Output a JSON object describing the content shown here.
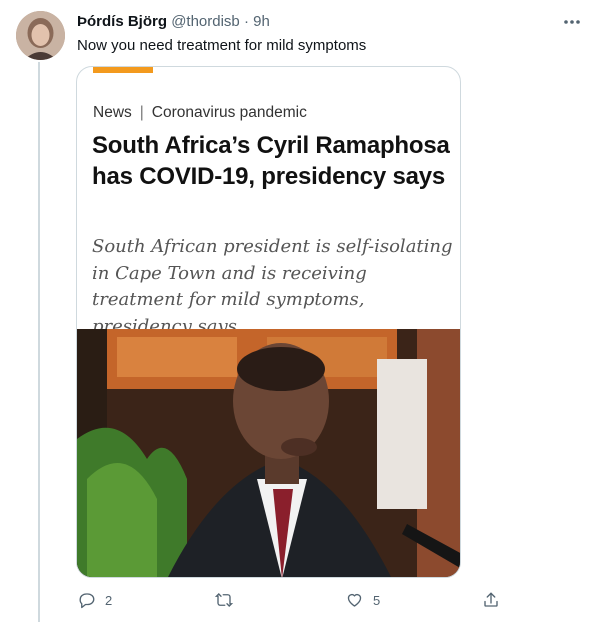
{
  "tweet": {
    "author_name": "Þórdís Björg",
    "author_handle": "@thordisb",
    "separator": "·",
    "time": "9h",
    "text": "Now you need treatment for mild symptoms",
    "avatar_icon": "avatar-photo"
  },
  "card": {
    "accent_color": "#f39a1e",
    "section": "News",
    "section_separator": "|",
    "topic": "Coronavirus pandemic",
    "headline": "South Africa’s Cyril Ramaphosa has COVID-19, presidency says",
    "standfirst": "South African president is self-isolating in Cape Town and is receiving treatment for mild symptoms, presidency says.",
    "image_icon": "news-photo"
  },
  "actions": {
    "reply_count": "2",
    "retweet_count": "",
    "like_count": "5",
    "icons": [
      "reply-icon",
      "retweet-icon",
      "like-icon",
      "share-icon"
    ]
  },
  "colors": {
    "text_primary": "#0f1419",
    "text_secondary": "#536471",
    "border": "#cfd9de"
  }
}
